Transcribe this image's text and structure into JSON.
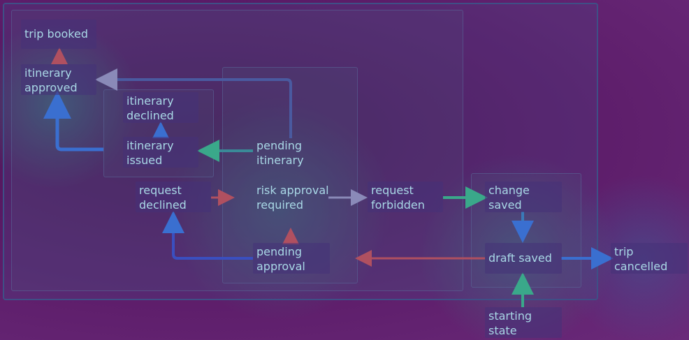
{
  "diagram": {
    "nodes": {
      "trip_booked": "trip booked",
      "itinerary_approved": "itinerary\napproved",
      "itinerary_declined": "itinerary\ndeclined",
      "itinerary_issued": "itinerary\nissued",
      "pending_itinerary": "pending\nitinerary",
      "request_declined": "request\ndeclined",
      "risk_approval_required": "risk approval\nrequired",
      "request_forbidden": "request\nforbidden",
      "change_saved": "change\nsaved",
      "draft_saved": "draft saved",
      "pending_approval": "pending\napproval",
      "trip_cancelled": "trip\ncancelled",
      "starting_state": "starting\nstate"
    },
    "edges": [
      {
        "from": "itinerary_approved",
        "to": "trip_booked"
      },
      {
        "from": "itinerary_issued",
        "to": "itinerary_approved"
      },
      {
        "from": "itinerary_issued",
        "to": "itinerary_declined"
      },
      {
        "from": "pending_itinerary",
        "to": "itinerary_approved"
      },
      {
        "from": "pending_itinerary",
        "to": "itinerary_issued"
      },
      {
        "from": "request_declined",
        "to": "risk_approval_required"
      },
      {
        "from": "risk_approval_required",
        "to": "request_forbidden"
      },
      {
        "from": "request_forbidden",
        "to": "change_saved"
      },
      {
        "from": "change_saved",
        "to": "draft_saved"
      },
      {
        "from": "draft_saved",
        "to": "pending_approval"
      },
      {
        "from": "draft_saved",
        "to": "trip_cancelled"
      },
      {
        "from": "pending_approval",
        "to": "request_declined"
      },
      {
        "from": "pending_approval",
        "to": "risk_approval_required"
      },
      {
        "from": "starting_state",
        "to": "draft_saved"
      }
    ],
    "colors": {
      "node_text": "#a9d8e6",
      "edge_blue": "#3a6fd0",
      "edge_teal": "#3aa88a",
      "edge_red": "#b05060",
      "edge_gray": "#8a8ab8",
      "frame": "#3f4f86"
    }
  }
}
